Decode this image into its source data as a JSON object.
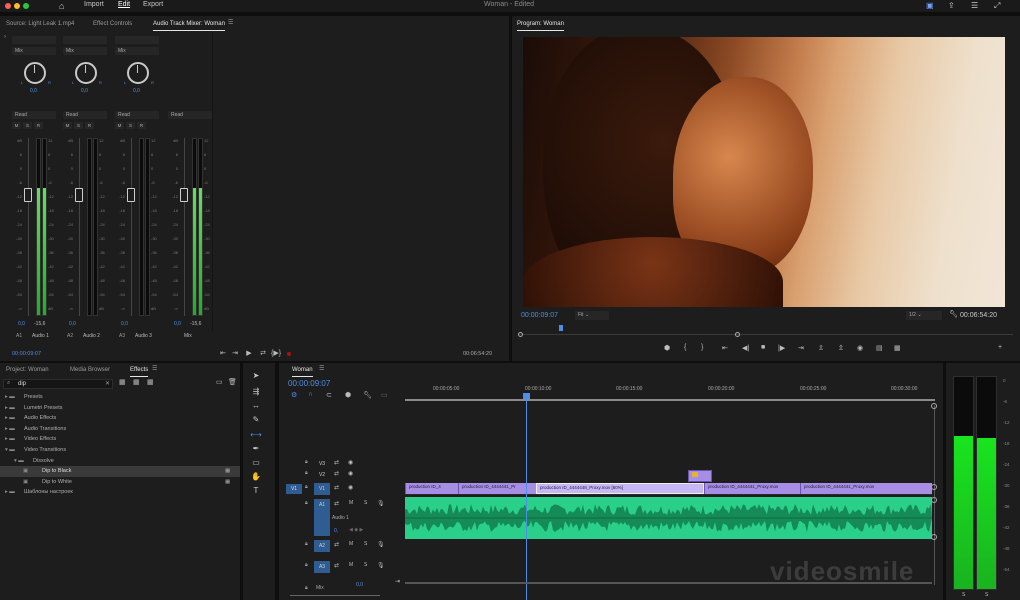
{
  "app": {
    "title": "Woman - Edited",
    "menu": [
      "Import",
      "Edit",
      "Export"
    ],
    "active_menu": "Edit"
  },
  "top_tabs": {
    "source": "Source: Light Leak 1.mp4",
    "effect_controls": "Effect Controls",
    "audio_mixer": "Audio Track Mixer: Woman",
    "program": "Program: Woman"
  },
  "mixer": {
    "channels": [
      {
        "mode": "Mix",
        "pan": "0,0",
        "read": "Read",
        "level": "0,0",
        "level2": "-15,6",
        "track": "A1",
        "name": "Audio 1",
        "meter": 0.72,
        "fader": 0.55
      },
      {
        "mode": "Mix",
        "pan": "0,0",
        "read": "Read",
        "level": "0,0",
        "level2": "",
        "track": "A2",
        "name": "Audio 2",
        "meter": 0,
        "fader": 0.55
      },
      {
        "mode": "Mix",
        "pan": "0,0",
        "read": "Read",
        "level": "0,0",
        "level2": "",
        "track": "A3",
        "name": "Audio 3",
        "meter": 0,
        "fader": 0.55
      },
      {
        "mode": "",
        "pan": "",
        "read": "Read",
        "level": "0,0",
        "level2": "-15,6",
        "track": "",
        "name": "Mix",
        "meter": 0.72,
        "fader": 0.55
      }
    ],
    "msr": [
      "M",
      "S",
      "R"
    ],
    "scale": [
      "dB",
      "6",
      "0",
      "-6",
      "-12",
      "-18",
      "-24",
      "-30",
      "-36",
      "-42",
      "-48",
      "-54",
      "-∞"
    ],
    "scale_right": [
      "12",
      "6",
      "0",
      "-6",
      "-12",
      "-18",
      "-24",
      "-30",
      "-36",
      "-42",
      "-48",
      "-54",
      "dB"
    ],
    "timecode": "00:00:09:07",
    "duration": "00:06:54:20"
  },
  "program": {
    "timecode": "00:00:09:07",
    "fit": "Fit",
    "resolution": "1/2",
    "duration": "00:06:54:20"
  },
  "project": {
    "tabs": [
      "Project: Woman",
      "Media Browser",
      "Effects"
    ],
    "active_tab": "Effects",
    "search": "dip",
    "tree": [
      {
        "label": "Presets",
        "level": 0,
        "sel": false
      },
      {
        "label": "Lumetri Presets",
        "level": 0,
        "sel": false
      },
      {
        "label": "Audio Effects",
        "level": 0,
        "sel": false
      },
      {
        "label": "Audio Transitions",
        "level": 0,
        "sel": false
      },
      {
        "label": "Video Effects",
        "level": 0,
        "sel": false
      },
      {
        "label": "Video Transitions",
        "level": 0,
        "sel": false
      },
      {
        "label": "Dissolve",
        "level": 1,
        "sel": false
      },
      {
        "label": "Dip to Black",
        "level": 2,
        "sel": true
      },
      {
        "label": "Dip to White",
        "level": 2,
        "sel": false
      },
      {
        "label": "Шаблоны настроек",
        "level": 0,
        "sel": false
      }
    ]
  },
  "timeline": {
    "tab": "Woman",
    "timecode": "00:00:09:07",
    "ruler": [
      "00:00:05:00",
      "00:00:10:00",
      "00:00:15:00",
      "00:00:20:00",
      "00:00:25:00",
      "00:00:30:00"
    ],
    "tracks": {
      "v3": "V3",
      "v2": "V2",
      "v1": "V1",
      "a1": "A1",
      "a1_name": "Audio 1",
      "a2": "A2",
      "a3": "A3",
      "mix": "Mix",
      "mix_val": "0,0",
      "a1_val": "0,"
    },
    "clips": [
      "production ID_4",
      "production ID_4444441_Pr",
      "production ID_4444448_Proxy.mov [60%]",
      "production ID_4444441_Proxy.mov",
      "production ID_4444441_Proxy.mov"
    ]
  },
  "right_meter": {
    "labels": [
      "0",
      "-6",
      "-12",
      "-18",
      "-24",
      "-30",
      "-36",
      "-42",
      "-48",
      "-54"
    ],
    "sr": [
      "S",
      "S"
    ],
    "left": 0.72,
    "right": 0.71
  },
  "watermark": "videosmile",
  "colors": {
    "accent": "#4d8fe8",
    "clip": "#a58ee4",
    "audio": "#2ad08a",
    "meter": "#1fc62a"
  }
}
